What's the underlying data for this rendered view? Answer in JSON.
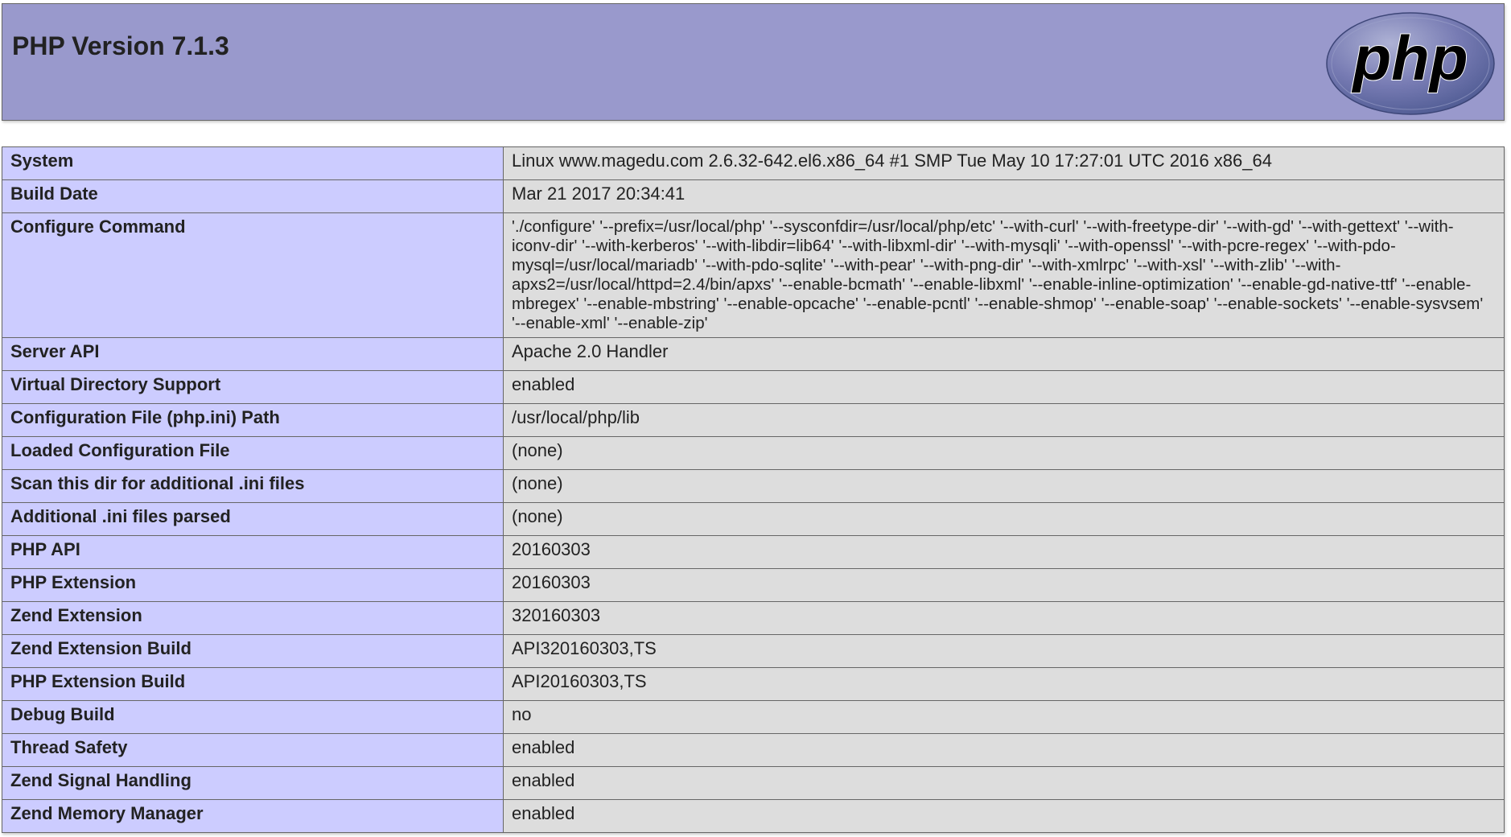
{
  "header": {
    "title": "PHP Version 7.1.3",
    "logo_text": "php",
    "logo_color": "#777bb3"
  },
  "colors": {
    "header_bg": "#9999cc",
    "key_bg": "#ccccff",
    "value_bg": "#dddddd",
    "border": "#666666"
  },
  "rows": [
    {
      "key": "System",
      "value": "Linux www.magedu.com 2.6.32-642.el6.x86_64 #1 SMP Tue May 10 17:27:01 UTC 2016 x86_64"
    },
    {
      "key": "Build Date",
      "value": "Mar 21 2017 20:34:41"
    },
    {
      "key": "Configure Command",
      "value": "'./configure' '--prefix=/usr/local/php' '--sysconfdir=/usr/local/php/etc' '--with-curl' '--with-freetype-dir' '--with-gd' '--with-gettext' '--with-iconv-dir' '--with-kerberos' '--with-libdir=lib64' '--with-libxml-dir' '--with-mysqli' '--with-openssl' '--with-pcre-regex' '--with-pdo-mysql=/usr/local/mariadb' '--with-pdo-sqlite' '--with-pear' '--with-png-dir' '--with-xmlrpc' '--with-xsl' '--with-zlib' '--with-apxs2=/usr/local/httpd=2.4/bin/apxs' '--enable-bcmath' '--enable-libxml' '--enable-inline-optimization' '--enable-gd-native-ttf' '--enable-mbregex' '--enable-mbstring' '--enable-opcache' '--enable-pcntl' '--enable-shmop' '--enable-soap' '--enable-sockets' '--enable-sysvsem' '--enable-xml' '--enable-zip'"
    },
    {
      "key": "Server API",
      "value": "Apache 2.0 Handler"
    },
    {
      "key": "Virtual Directory Support",
      "value": "enabled"
    },
    {
      "key": "Configuration File (php.ini) Path",
      "value": "/usr/local/php/lib"
    },
    {
      "key": "Loaded Configuration File",
      "value": "(none)"
    },
    {
      "key": "Scan this dir for additional .ini files",
      "value": "(none)"
    },
    {
      "key": "Additional .ini files parsed",
      "value": "(none)"
    },
    {
      "key": "PHP API",
      "value": "20160303"
    },
    {
      "key": "PHP Extension",
      "value": "20160303"
    },
    {
      "key": "Zend Extension",
      "value": "320160303"
    },
    {
      "key": "Zend Extension Build",
      "value": "API320160303,TS"
    },
    {
      "key": "PHP Extension Build",
      "value": "API20160303,TS"
    },
    {
      "key": "Debug Build",
      "value": "no"
    },
    {
      "key": "Thread Safety",
      "value": "enabled"
    },
    {
      "key": "Zend Signal Handling",
      "value": "enabled"
    },
    {
      "key": "Zend Memory Manager",
      "value": "enabled"
    }
  ]
}
